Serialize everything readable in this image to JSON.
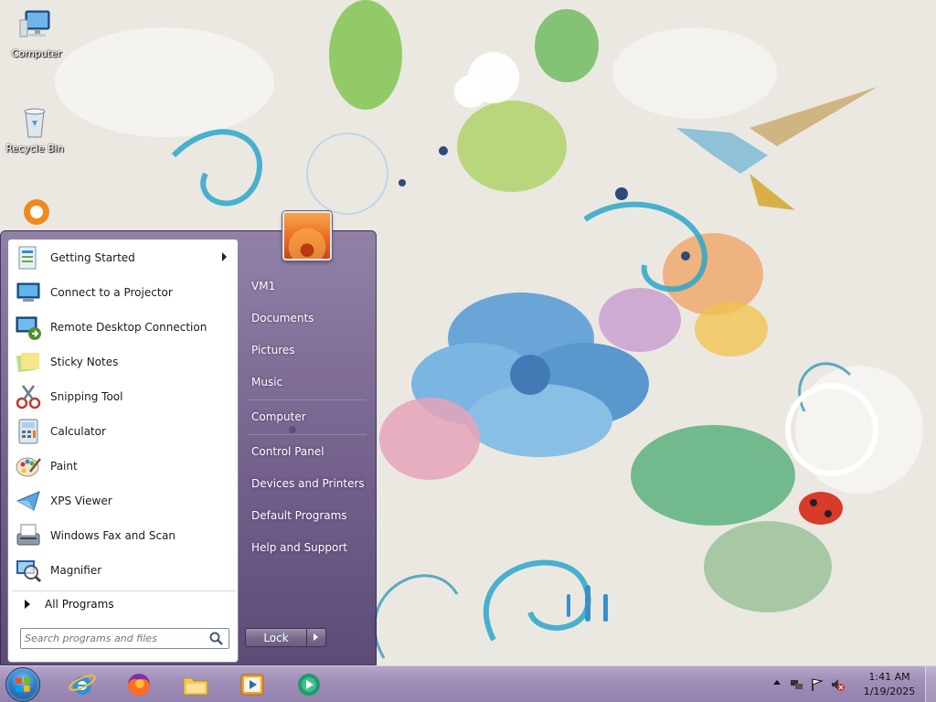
{
  "desktop": {
    "icons": [
      {
        "label": "Computer",
        "icon": "computer-icon"
      },
      {
        "label": "Recycle Bin",
        "icon": "recycle-bin-icon"
      }
    ]
  },
  "start_menu": {
    "programs": [
      {
        "label": "Getting Started",
        "icon": "getting-started-icon",
        "has_submenu": true
      },
      {
        "label": "Connect to a Projector",
        "icon": "projector-icon"
      },
      {
        "label": "Remote Desktop Connection",
        "icon": "remote-desktop-icon"
      },
      {
        "label": "Sticky Notes",
        "icon": "sticky-notes-icon"
      },
      {
        "label": "Snipping Tool",
        "icon": "scissors-icon"
      },
      {
        "label": "Calculator",
        "icon": "calculator-icon"
      },
      {
        "label": "Paint",
        "icon": "paint-palette-icon"
      },
      {
        "label": "XPS Viewer",
        "icon": "xps-viewer-icon"
      },
      {
        "label": "Windows Fax and Scan",
        "icon": "fax-icon"
      },
      {
        "label": "Magnifier",
        "icon": "magnifier-icon"
      }
    ],
    "all_programs_label": "All Programs",
    "search": {
      "placeholder": "Search programs and files"
    },
    "right_pane": {
      "items": [
        {
          "label": "VM1"
        },
        {
          "label": "Documents"
        },
        {
          "label": "Pictures"
        },
        {
          "label": "Music"
        },
        {
          "label": "Computer"
        },
        {
          "label": "Control Panel"
        },
        {
          "label": "Devices and Printers"
        },
        {
          "label": "Default Programs"
        },
        {
          "label": "Help and Support"
        }
      ]
    },
    "lock_label": "Lock"
  },
  "taskbar": {
    "pinned": [
      {
        "name": "internet-explorer-icon"
      },
      {
        "name": "firefox-icon"
      },
      {
        "name": "file-explorer-icon"
      },
      {
        "name": "media-player-icon"
      },
      {
        "name": "media-center-icon"
      }
    ],
    "clock": {
      "time": "1:41 AM",
      "date": "1/19/2025"
    }
  },
  "colors": {
    "taskbar": "#9f8db5",
    "start_menu": "#6f5c8c",
    "accent": "#2f7fc8"
  }
}
